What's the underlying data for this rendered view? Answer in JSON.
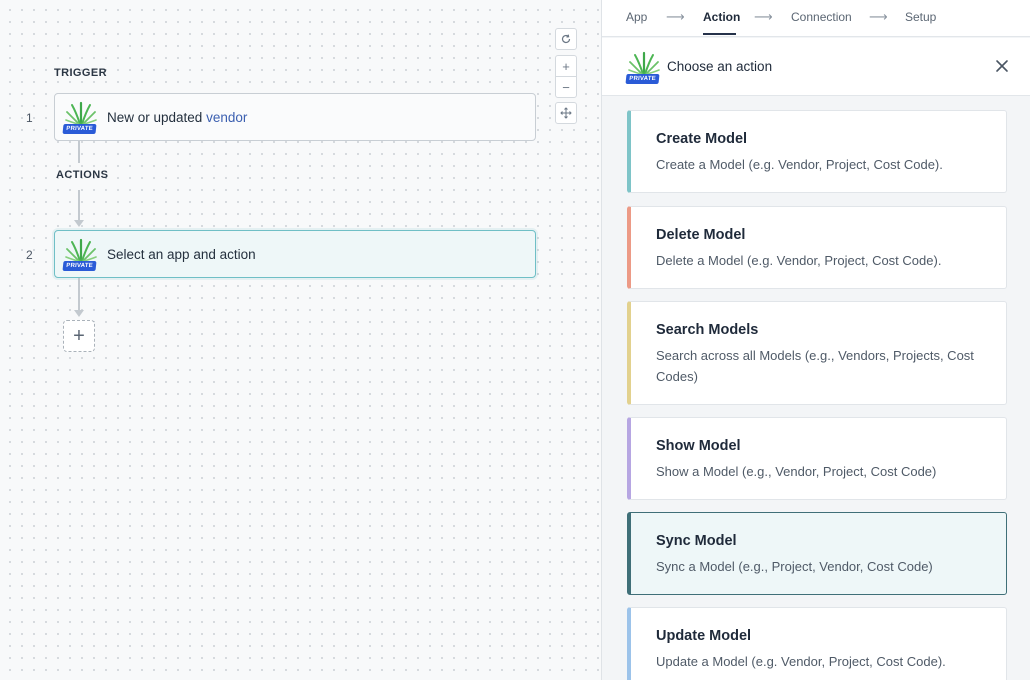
{
  "canvas": {
    "trigger_label": "TRIGGER",
    "actions_label": "ACTIONS",
    "steps": [
      {
        "number": "1",
        "text": "New or updated ",
        "highlight": "vendor",
        "badge": "PRIVATE"
      },
      {
        "number": "2",
        "text": "Select an app and action",
        "badge": "PRIVATE"
      }
    ],
    "add_step_symbol": "+",
    "zoom": {
      "plus": "+",
      "minus": "−"
    }
  },
  "panel": {
    "stepper": [
      {
        "label": "App",
        "active": false
      },
      {
        "label": "Action",
        "active": true
      },
      {
        "label": "Connection",
        "active": false
      },
      {
        "label": "Setup",
        "active": false
      }
    ],
    "header": {
      "title": "Choose an action",
      "badge": "PRIVATE"
    },
    "actions": [
      {
        "title": "Create Model",
        "description": "Create a Model (e.g. Vendor, Project, Cost Code).",
        "accent": "#7ec4c8"
      },
      {
        "title": "Delete Model",
        "description": "Delete a Model (e.g. Vendor, Project, Cost Code).",
        "accent": "#ec9a86"
      },
      {
        "title": "Search Models",
        "description": "Search across all Models (e.g., Vendors, Projects, Cost Codes)",
        "accent": "#e2d18e"
      },
      {
        "title": "Show Model",
        "description": "Show a Model (e.g., Vendor, Project, Cost Code)",
        "accent": "#b6a6e2"
      },
      {
        "title": "Sync Model",
        "description": "Sync a Model (e.g., Project, Vendor, Cost Code)",
        "accent": "#3f6f78"
      },
      {
        "title": "Update Model",
        "description": "Update a Model (e.g. Vendor, Project, Cost Code).",
        "accent": "#9cc3ea"
      }
    ]
  },
  "colors": {
    "private_badge": "#2a5bd7",
    "selected_border": "#3f6f78",
    "link": "#3b5fb0"
  }
}
